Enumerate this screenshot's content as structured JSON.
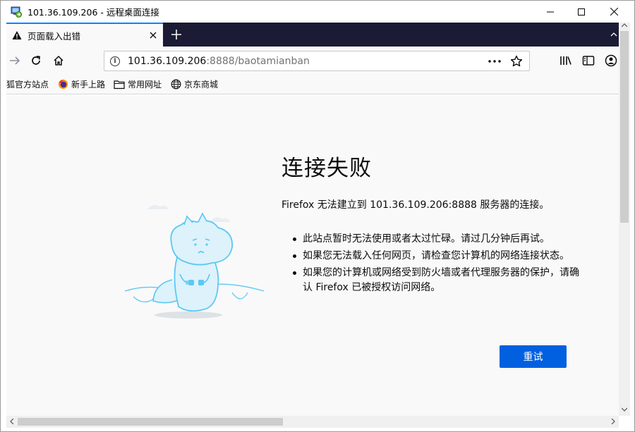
{
  "rdp": {
    "title": "101.36.109.206 - 远程桌面连接",
    "icon": "remote-desktop-icon"
  },
  "tab": {
    "title": "页面载入出错",
    "icon": "warning-icon"
  },
  "urlbar": {
    "host": "101.36.109.206",
    "rest": ":8888/baotamianban"
  },
  "bookmarks": [
    {
      "label": "狐官方站点",
      "icon": "none"
    },
    {
      "label": "新手上路",
      "icon": "firefox-icon"
    },
    {
      "label": "常用网址",
      "icon": "folder-icon"
    },
    {
      "label": "京东商城",
      "icon": "globe-icon"
    }
  ],
  "error": {
    "title": "连接失败",
    "description": "Firefox 无法建立到 101.36.109.206:8888 服务器的连接。",
    "items": [
      "此站点暂时无法使用或者太过忙碌。请过几分钟后再试。",
      "如果您无法载入任何网页，请检查您计算机的网络连接状态。",
      "如果您的计算机或网络受到防火墙或者代理服务器的保护，请确认 Firefox 已被授权访问网络。"
    ],
    "retry_label": "重试"
  },
  "colors": {
    "tabstrip": "#1c1b35",
    "accent": "#0a84ff",
    "button": "#0060df",
    "illustration": "#5cc8f2"
  }
}
